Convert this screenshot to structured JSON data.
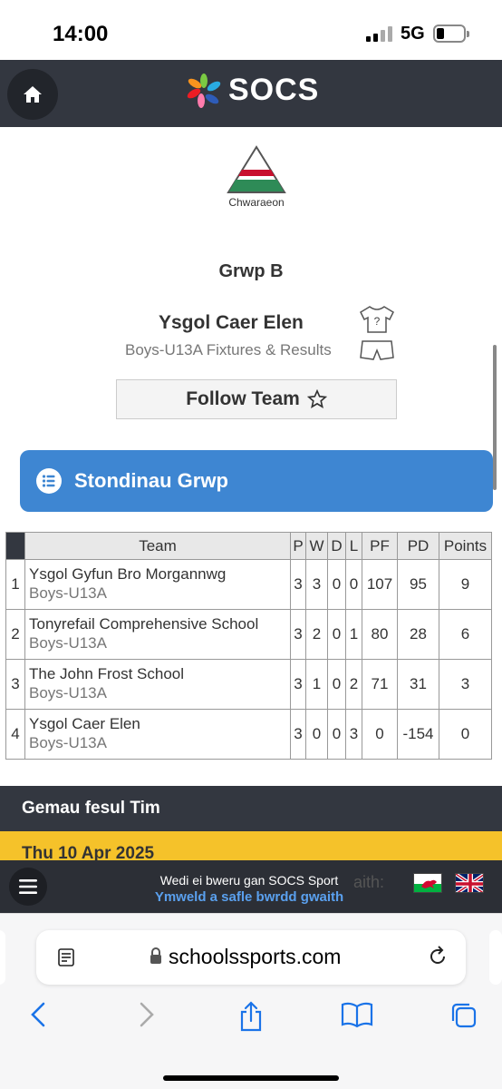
{
  "status_bar": {
    "time": "14:00",
    "network": "5G"
  },
  "header": {
    "brand": "SOCS"
  },
  "crest": {
    "label": "Chwaraeon"
  },
  "group": {
    "title": "Grwp B"
  },
  "team": {
    "name": "Ysgol Caer Elen",
    "subtitle": "Boys-U13A Fixtures & Results",
    "follow_label": "Follow Team"
  },
  "section": {
    "standings_label": "Stondinau Grwp"
  },
  "standings": {
    "headers": {
      "team": "Team",
      "p": "P",
      "w": "W",
      "d": "D",
      "l": "L",
      "pf": "PF",
      "pd": "PD",
      "points": "Points"
    },
    "rows": [
      {
        "pos": "1",
        "team": "Ysgol Gyfun Bro Morgannwg",
        "age": "Boys-U13A",
        "p": "3",
        "w": "3",
        "d": "0",
        "l": "0",
        "pf": "107",
        "pd": "95",
        "points": "9"
      },
      {
        "pos": "2",
        "team": "Tonyrefail Comprehensive School",
        "age": "Boys-U13A",
        "p": "3",
        "w": "2",
        "d": "0",
        "l": "1",
        "pf": "80",
        "pd": "28",
        "points": "6"
      },
      {
        "pos": "3",
        "team": "The John Frost School",
        "age": "Boys-U13A",
        "p": "3",
        "w": "1",
        "d": "0",
        "l": "2",
        "pf": "71",
        "pd": "31",
        "points": "3"
      },
      {
        "pos": "4",
        "team": "Ysgol Caer Elen",
        "age": "Boys-U13A",
        "p": "3",
        "w": "0",
        "d": "0",
        "l": "3",
        "pf": "0",
        "pd": "-154",
        "points": "0"
      }
    ]
  },
  "fixtures": {
    "section_label": "Gemau fesul Tim",
    "date_label": "Thu 10 Apr 2025"
  },
  "footer": {
    "powered_by": "Wedi ei bweru gan SOCS Sport",
    "visit_link": "Ymweld a safle bwrdd gwaith",
    "obscured_text": "aith:"
  },
  "browser": {
    "url": "schoolssports.com"
  },
  "colors": {
    "header_bg": "#333740",
    "accent_blue": "#3e86d2",
    "date_yellow": "#f5c22a",
    "link_blue": "#5aa0ee"
  }
}
